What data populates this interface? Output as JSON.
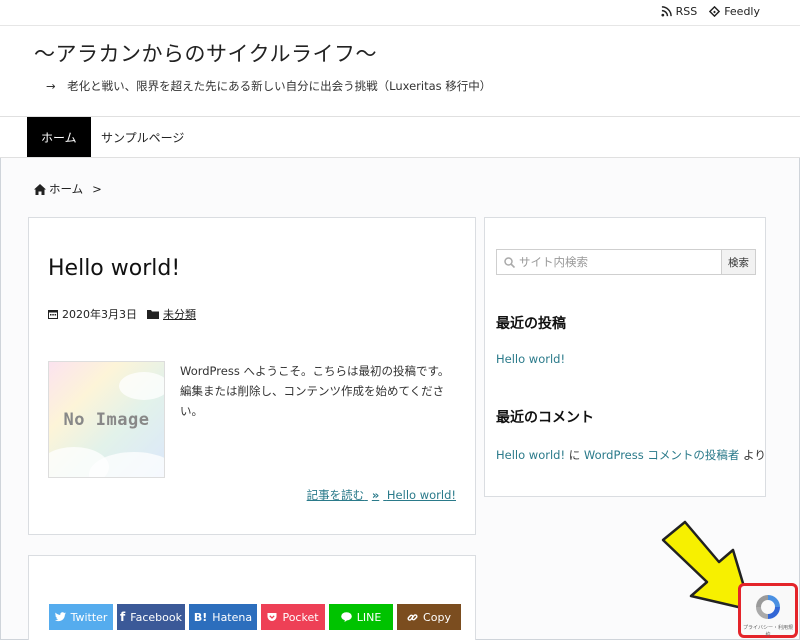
{
  "topbar": {
    "rss_label": "RSS",
    "feedly_label": "Feedly"
  },
  "header": {
    "site_title": "〜アラカンからのサイクルライフ〜",
    "tagline": "→　老化と戦い、限界を超えた先にある新しい自分に出会う挑戦（Luxeritas 移行中）"
  },
  "nav": {
    "items": [
      {
        "label": "ホーム"
      },
      {
        "label": "サンプルページ"
      }
    ]
  },
  "breadcrumb": {
    "home": "ホーム",
    "sep": ">"
  },
  "post": {
    "title": "Hello world!",
    "date": "2020年3月3日",
    "category": "未分類",
    "thumbnail_text": "No Image",
    "excerpt": "WordPress へようこそ。こちらは最初の投稿です。編集または削除し、コンテンツ作成を始めてください。",
    "read_more": "記事を読む",
    "read_more_target": "Hello world!"
  },
  "share": {
    "buttons": [
      {
        "label": "Twitter",
        "color": "#55acee"
      },
      {
        "label": "Facebook",
        "color": "#3b5998"
      },
      {
        "label": "Hatena",
        "color": "#2c6ebd"
      },
      {
        "label": "Pocket",
        "color": "#ee4056"
      },
      {
        "label": "LINE",
        "color": "#00c300"
      },
      {
        "label": "Copy",
        "color": "#7b4d1f"
      }
    ],
    "hatena_mark": "B!"
  },
  "sidebar": {
    "search_placeholder": "サイト内検索",
    "search_button": "検索",
    "recent_posts_title": "最近の投稿",
    "recent_posts": [
      "Hello world!"
    ],
    "recent_comments_title": "最近のコメント",
    "comment": {
      "post": "Hello world!",
      "on": "に",
      "author": "WordPress コメントの投稿者",
      "by": "より"
    }
  },
  "recaptcha": {
    "text": "プライバシー・利用規約"
  },
  "colors": {
    "accent": "#2a7a8a",
    "highlight": "#e4242a",
    "arrow": "#f7f000"
  }
}
